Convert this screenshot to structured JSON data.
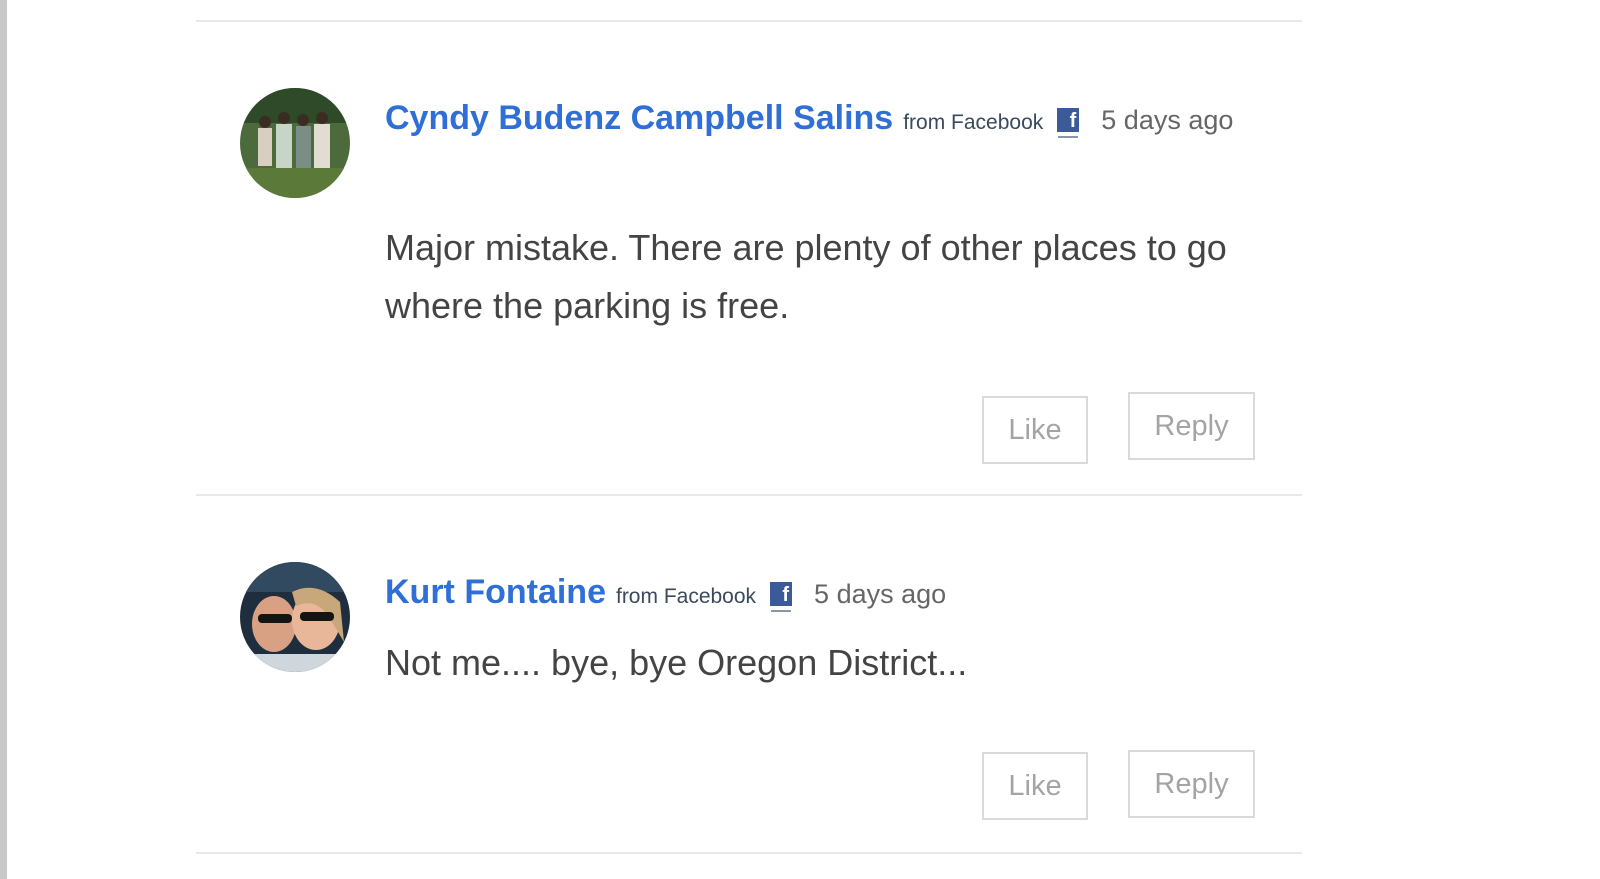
{
  "comments": [
    {
      "author": "Cyndy Budenz Campbell Salins",
      "source": "from Facebook",
      "icon": "facebook-icon",
      "icon_glyph": "f",
      "timestamp": "5 days ago",
      "text": "Major mistake. There are plenty of other places to go where the parking is free.",
      "like_label": "Like",
      "reply_label": "Reply"
    },
    {
      "author": "Kurt Fontaine",
      "source": "from Facebook",
      "icon": "facebook-icon",
      "icon_glyph": "f",
      "timestamp": "5 days ago",
      "text": "Not me.... bye, bye Oregon District...",
      "like_label": "Like",
      "reply_label": "Reply"
    }
  ],
  "colors": {
    "author_link": "#2f6fd6",
    "facebook_blue": "#3b5a9a",
    "button_border": "#dadada",
    "button_text": "#a4a4a4",
    "divider": "#e8e8e8"
  }
}
